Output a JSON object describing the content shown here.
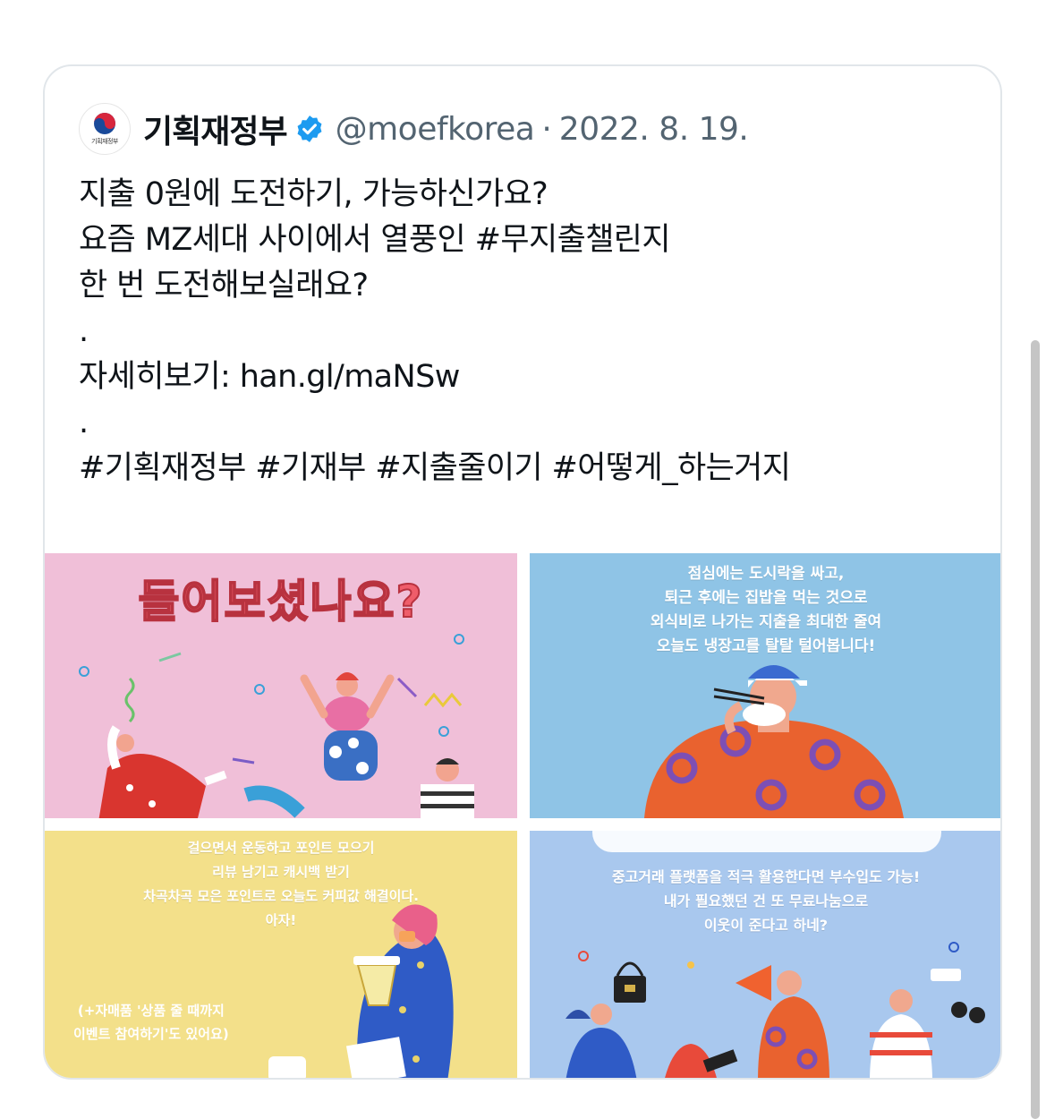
{
  "tweet": {
    "author": {
      "name": "기획재정부",
      "handle": "@moefkorea",
      "avatar_label": "기획재정부",
      "verified": true,
      "verified_icon": "verified-badge-icon"
    },
    "separator": "·",
    "date": "2022. 8. 19.",
    "text_lines": [
      "지출 0원에 도전하기, 가능하신가요?",
      "요즘 MZ세대 사이에서 열풍인 #무지출챌린지",
      "한 번 도전해보실래요?",
      ".",
      "자세히보기: han.gl/maNSw",
      ".",
      "#기획재정부 #기재부 #지출줄이기 #어떻게_하는거지"
    ],
    "media": [
      {
        "headline": "들어보셨나요?",
        "caption_lines": []
      },
      {
        "caption_lines": [
          "점심에는 도시락을 싸고,",
          "퇴근 후에는 집밥을 먹는 것으로",
          "외식비로 나가는 지출을 최대한 줄여",
          "오늘도 냉장고를 탈탈 털어봅니다!"
        ]
      },
      {
        "caption_lines": [
          "걸으면서 운동하고 포인트 모으기",
          "리뷰 남기고 캐시백 받기",
          "차곡차곡 모은 포인트로 오늘도 커피값 해결이다.",
          "아자!"
        ],
        "note_lines": [
          "(+자매품 '상품 줄 때까지",
          "이벤트 참여하기'도 있어요)"
        ]
      },
      {
        "caption_lines": [
          "중고거래 플랫폼을 적극 활용한다면 부수입도 가능!",
          "내가 필요했던 건 또 무료나눔으로",
          "이웃이 준다고 하네?"
        ]
      }
    ]
  },
  "colors": {
    "text": "#0f1419",
    "muted": "#536471",
    "verified": "#1d9bf0",
    "border": "#e1e6ea",
    "tile_pink": "#f0bfd8",
    "tile_blue": "#8fc4e6",
    "tile_yellow": "#f3e08a",
    "tile_lightblue": "#a9c8ee"
  }
}
